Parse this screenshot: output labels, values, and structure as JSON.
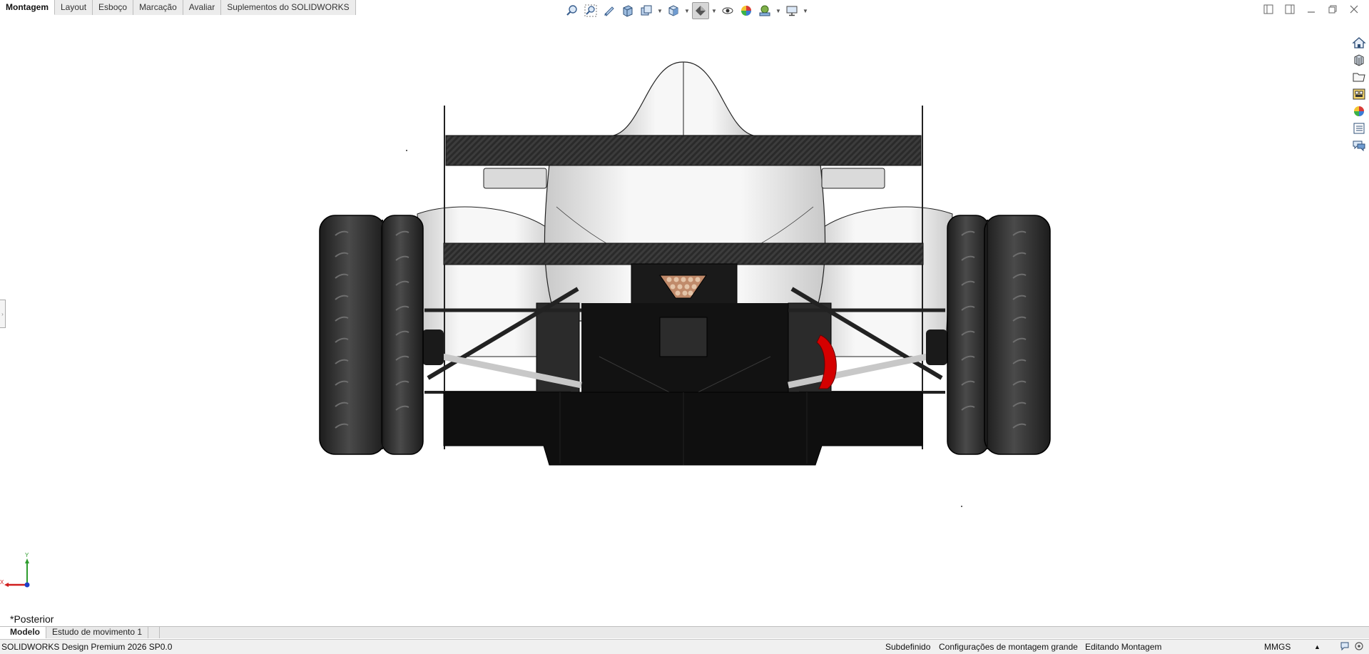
{
  "command_tabs": [
    "Montagem",
    "Layout",
    "Esboço",
    "Marcação",
    "Avaliar",
    "Suplementos do SOLIDWORKS"
  ],
  "hud_toolbar": {
    "icons": [
      "zoom-to-fit-icon",
      "zoom-to-area-icon",
      "previous-view-icon",
      "section-view-icon",
      "dynamic-annotation-views-icon",
      "view-orientation-icon",
      "display-style-icon",
      "hide-show-items-icon",
      "edit-appearance-icon",
      "apply-scene-icon",
      "view-settings-icon"
    ]
  },
  "task_pane": {
    "icons": [
      "solidworks-resources-icon",
      "design-library-icon",
      "file-explorer-icon",
      "view-palette-icon",
      "appearances-scenes-icon",
      "custom-properties-icon",
      "forum-icon"
    ]
  },
  "viewport": {
    "view_name": "*Posterior",
    "triad": {
      "y_label": "Y",
      "x_label": "X"
    }
  },
  "bottom_tabs": [
    "Modelo",
    "Estudo de movimento 1"
  ],
  "status_bar": {
    "product": "SOLIDWORKS Design Premium 2026 SP0.0",
    "definition_state": "Subdefinido",
    "config": "Configurações de montagem grande",
    "mode": "Editando Montagem",
    "units": "MMGS"
  },
  "colors": {
    "tab_active_bg": "#ffffff",
    "tab_bg": "#ececec",
    "statusbar_bg": "#f0f0f0",
    "car_body": "#ececec",
    "carbon": "#2b2b2b",
    "tire": "#2e2e2e",
    "brake_caliper": "#d40000",
    "taillight": "#c08a6a"
  }
}
